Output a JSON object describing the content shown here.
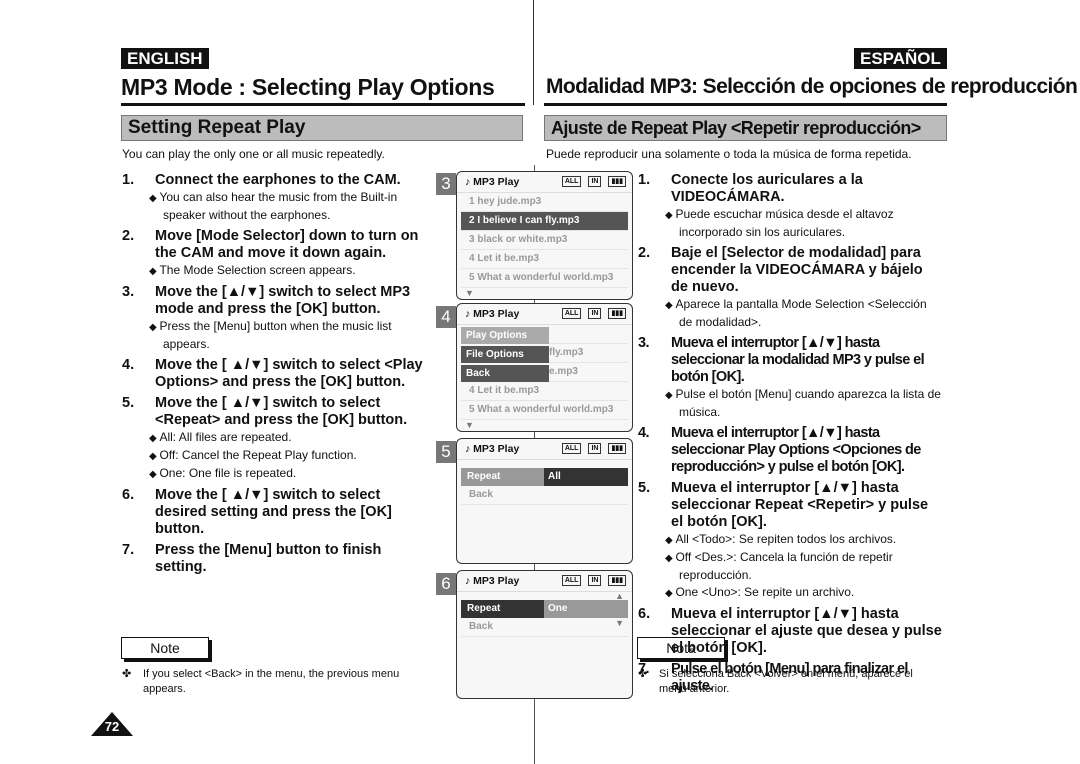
{
  "header": {
    "lang_left": "ENGLISH",
    "lang_right": "ESPAÑOL",
    "title_left": "MP3 Mode : Selecting Play Options",
    "title_right": "Modalidad MP3: Selección de opciones de reproducción"
  },
  "left": {
    "section": "Setting Repeat Play",
    "intro": "You can play the only one or all music repeatedly.",
    "steps": [
      {
        "n": "1.",
        "text": "Connect the earphones to the CAM.",
        "bullets": [
          "You can also hear the music from the Built-in speaker without the earphones."
        ]
      },
      {
        "n": "2.",
        "text": "Move [Mode Selector] down to turn on the CAM and move it down again.",
        "bullets": [
          "The Mode Selection screen appears."
        ]
      },
      {
        "n": "3.",
        "text": "Move the [▲/▼] switch to select MP3 mode and press the [OK] button.",
        "bullets": [
          "Press the [Menu] button when the music list appears."
        ]
      },
      {
        "n": "4.",
        "text": "Move the [ ▲/▼] switch to select <Play Options> and press the [OK] button.",
        "bullets": []
      },
      {
        "n": "5.",
        "text": "Move the [ ▲/▼] switch to select <Repeat> and press the [OK] button.",
        "bullets": [
          "All: All files are repeated.",
          "Off: Cancel the Repeat Play function.",
          "One: One file is repeated."
        ]
      },
      {
        "n": "6.",
        "text": "Move the [ ▲/▼] switch to select desired setting and press the [OK] button.",
        "bullets": []
      },
      {
        "n": "7.",
        "text": "Press the [Menu] button to finish setting.",
        "bullets": []
      }
    ],
    "note_label": "Note",
    "note": "If you select <Back> in the menu, the previous menu appears."
  },
  "right": {
    "section": "Ajuste de Repeat Play <Repetir reproducción>",
    "intro": "Puede reproducir una solamente o toda la música de forma repetida.",
    "steps": [
      {
        "n": "1.",
        "text": "Conecte los auriculares a la VIDEOCÁMARA.",
        "bullets": [
          "Puede escuchar música desde el altavoz incorporado sin los auriculares."
        ]
      },
      {
        "n": "2.",
        "text": "Baje el [Selector de modalidad] para encender la VIDEOCÁMARA y bájelo de nuevo.",
        "bullets": [
          "Aparece la pantalla Mode Selection <Selección de modalidad>."
        ]
      },
      {
        "n": "3.",
        "text": "Mueva el interruptor [▲/▼] hasta seleccionar la modalidad MP3 y pulse el botón [OK].",
        "bullets": [
          "Pulse el botón [Menu] cuando aparezca la lista de música."
        ]
      },
      {
        "n": "4.",
        "text": "Mueva el interruptor [▲/▼] hasta seleccionar Play Options <Opciones de reproducción> y pulse el botón [OK].",
        "bullets": []
      },
      {
        "n": "5.",
        "text": "Mueva el interruptor [▲/▼] hasta seleccionar Repeat <Repetir> y pulse el botón [OK].",
        "bullets": [
          "All <Todo>: Se repiten todos los archivos.",
          "Off <Des.>: Cancela la función de repetir reproducción.",
          "One <Uno>: Se repite un archivo."
        ]
      },
      {
        "n": "6.",
        "text": "Mueva el interruptor [▲/▼] hasta seleccionar el ajuste que desea y pulse el botón [OK].",
        "bullets": []
      },
      {
        "n": "7.",
        "text": "Pulse el botón [Menu] para finalizar el ajuste.",
        "bullets": []
      }
    ],
    "note_label": "Nota",
    "note": "Si selecciona Back <Volver> en el menú, aparece el menú anterior."
  },
  "screens": {
    "header": "MP3 Play",
    "icon_all": "ALL",
    "icon_mode": "IN",
    "s3": {
      "num": "3",
      "rows": [
        "1  hey jude.mp3",
        "2  I believe I can fly.mp3",
        "3  black or white.mp3",
        "4  Let it be.mp3",
        "5  What a wonderful world.mp3"
      ]
    },
    "s4": {
      "num": "4",
      "menu": [
        "Play Options",
        "File Options",
        "Back"
      ],
      "rows": [
        "",
        "fly.mp3",
        "e.mp3",
        "4  Let it be.mp3",
        "5  What a wonderful world.mp3"
      ]
    },
    "s5": {
      "num": "5",
      "label": "Repeat",
      "value": "All",
      "back": "Back"
    },
    "s6": {
      "num": "6",
      "label": "Repeat",
      "value": "One",
      "back": "Back"
    }
  },
  "page_number": "72"
}
